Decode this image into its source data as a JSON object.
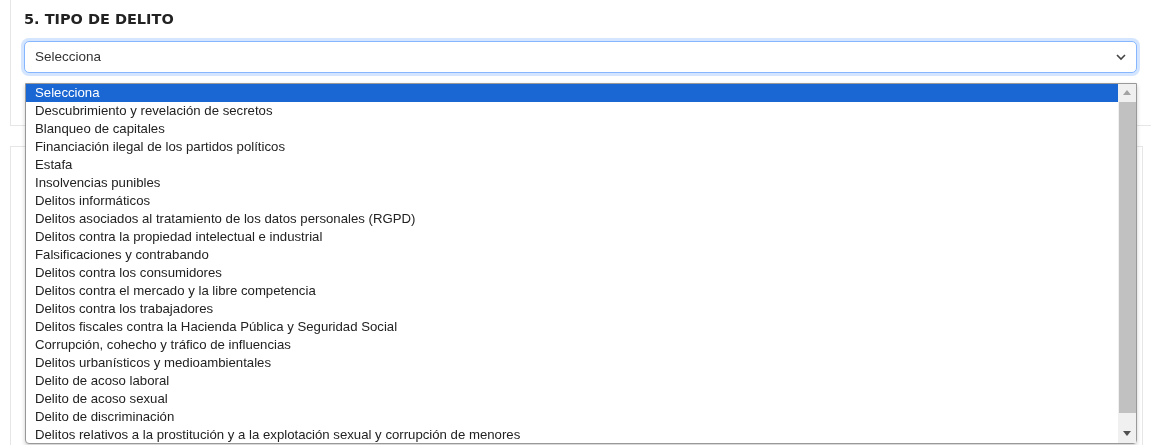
{
  "section": {
    "title": "5. TIPO DE DELITO"
  },
  "select": {
    "value": "Selecciona",
    "expanded": true
  },
  "options": [
    {
      "label": "Selecciona",
      "selected": true
    },
    {
      "label": "Descubrimiento y revelación de secretos",
      "selected": false
    },
    {
      "label": "Blanqueo de capitales",
      "selected": false
    },
    {
      "label": "Financiación ilegal de los partidos políticos",
      "selected": false
    },
    {
      "label": "Estafa",
      "selected": false
    },
    {
      "label": "Insolvencias punibles",
      "selected": false
    },
    {
      "label": "Delitos informáticos",
      "selected": false
    },
    {
      "label": "Delitos asociados al tratamiento de los datos personales (RGPD)",
      "selected": false
    },
    {
      "label": "Delitos contra la propiedad intelectual e industrial",
      "selected": false
    },
    {
      "label": "Falsificaciones y contrabando",
      "selected": false
    },
    {
      "label": "Delitos contra los consumidores",
      "selected": false
    },
    {
      "label": "Delitos contra el mercado y la libre competencia",
      "selected": false
    },
    {
      "label": "Delitos contra los trabajadores",
      "selected": false
    },
    {
      "label": "Delitos fiscales contra la Hacienda Pública y Seguridad Social",
      "selected": false
    },
    {
      "label": "Corrupción, cohecho y tráfico de influencias",
      "selected": false
    },
    {
      "label": "Delitos urbanísticos y medioambientales",
      "selected": false
    },
    {
      "label": "Delito de acoso laboral",
      "selected": false
    },
    {
      "label": "Delito de acoso sexual",
      "selected": false
    },
    {
      "label": "Delito de discriminación",
      "selected": false
    },
    {
      "label": "Delitos relativos a la prostitución y a la explotación sexual y corrupción de menores",
      "selected": false
    }
  ]
}
